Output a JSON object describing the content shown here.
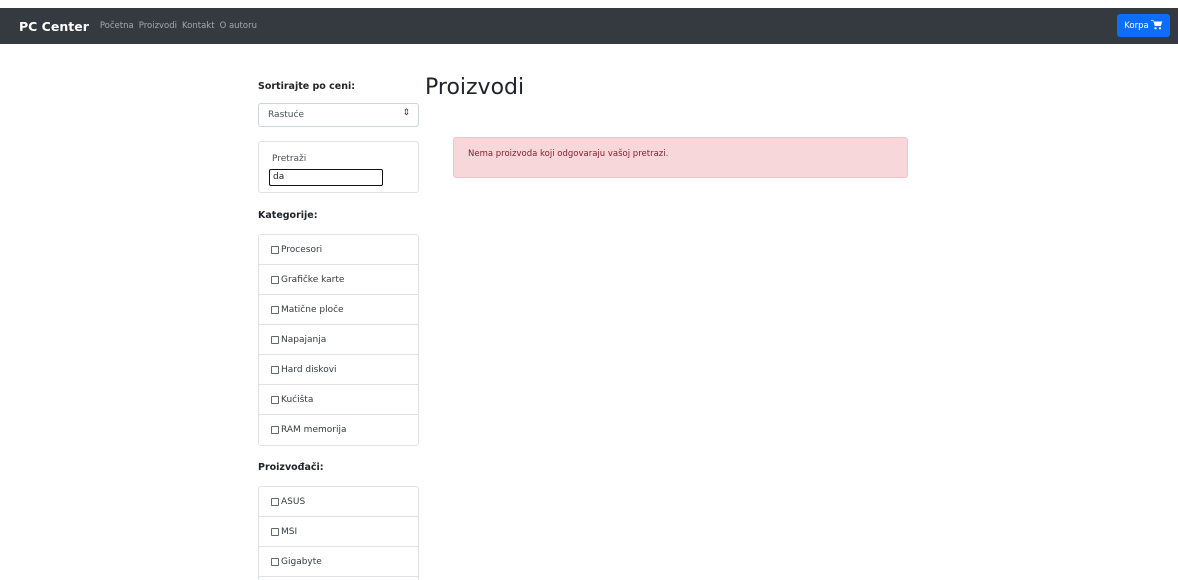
{
  "navbar": {
    "brand": "PC Center",
    "links": [
      "Početna",
      "Proizvodi",
      "Kontakt",
      "O autoru"
    ],
    "cart_label": "Korpa"
  },
  "sidebar": {
    "sort_label": "Sortirajte po ceni:",
    "sort_selected": "Rastuće",
    "search_label": "Pretraži",
    "search_value": "da",
    "categories_label": "Kategorije:",
    "categories": [
      "Procesori",
      "Grafičke karte",
      "Matične ploče",
      "Napajanja",
      "Hard diskovi",
      "Kućišta",
      "RAM memorija"
    ],
    "manufacturers_label": "Proizvođači:",
    "manufacturers": [
      "ASUS",
      "MSI",
      "Gigabyte"
    ]
  },
  "main": {
    "title": "Proizvodi",
    "alert": "Nema proizvoda koji odgovaraju vašoj pretrazi."
  },
  "colors": {
    "navbar_bg": "#343a40",
    "cart_bg": "#0d6efd",
    "alert_bg": "#f8d7da",
    "alert_text": "#842029"
  }
}
